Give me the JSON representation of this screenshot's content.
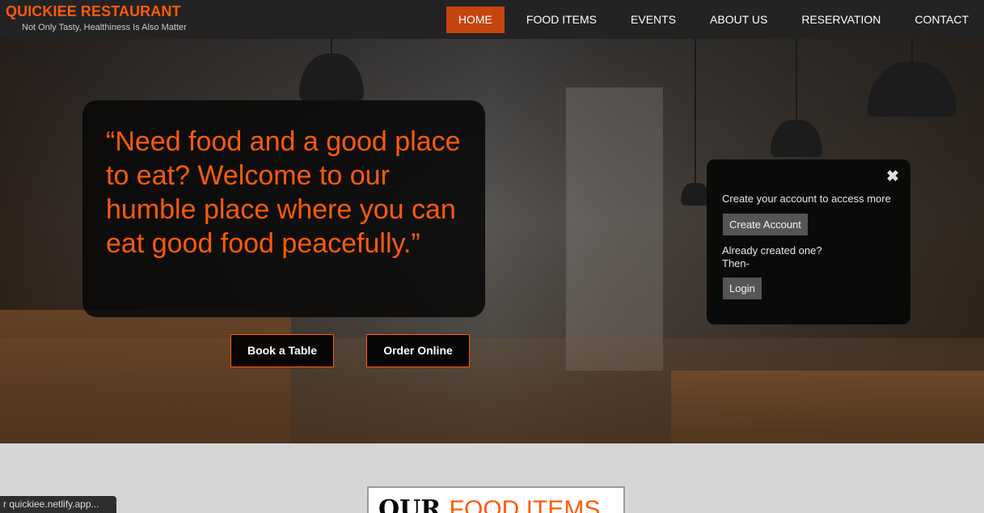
{
  "brand": {
    "title": "QUICKIEE RESTAURANT",
    "tagline": "Not Only Tasty, Healthiness Is Also Matter"
  },
  "nav": {
    "items": [
      {
        "label": "HOME",
        "active": true
      },
      {
        "label": "FOOD ITEMS",
        "active": false
      },
      {
        "label": "EVENTS",
        "active": false
      },
      {
        "label": "ABOUT US",
        "active": false
      },
      {
        "label": "RESERVATION",
        "active": false
      },
      {
        "label": "CONTACT",
        "active": false
      }
    ]
  },
  "hero": {
    "quote": "“Need food and a good place to eat? Welcome to our humble place where you can eat good food peacefully.”",
    "book_button": "Book a Table",
    "order_button": "Order Online"
  },
  "popup": {
    "close_glyph": "✖",
    "message": "Create your account to access more",
    "create_button": "Create Account",
    "already_line1": "Already created one?",
    "already_line2": "Then-",
    "login_button": "Login"
  },
  "section": {
    "title_dark": "OUR ",
    "title_accent": "FOOD ITEMS"
  },
  "status_bar": {
    "url": "r quickiee.netlify.app..."
  },
  "colors": {
    "accent": "#ff5a0a",
    "nav_active": "#c6440e",
    "header_bg": "#232323"
  }
}
